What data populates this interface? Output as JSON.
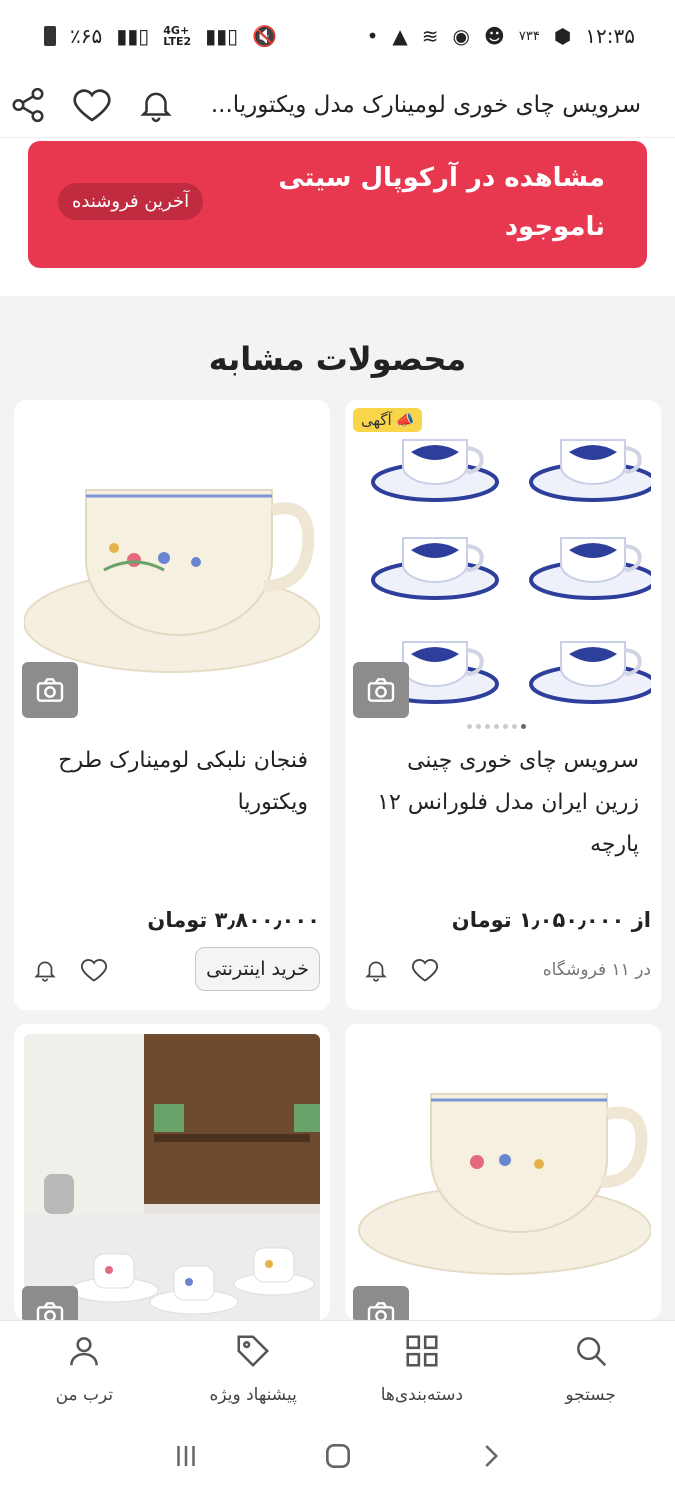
{
  "status_bar": {
    "time": "۱۲:۳۵",
    "battery": "٪۶۵",
    "network1": "4G+",
    "network2": "LTE2",
    "extra": "۷۳۴"
  },
  "header": {
    "title": "سرویس چای خوری لومینارک مدل ویکتوریا...",
    "icons": [
      "share-icon",
      "heart-icon",
      "bell-icon"
    ]
  },
  "banner": {
    "store_line": "مشاهده در آرکوپال سیتی",
    "availability": "ناموجود",
    "badge": "آخرین فروشنده",
    "color": "#e8384f"
  },
  "similar": {
    "title": "محصولات مشابه",
    "products": [
      {
        "name": "سرویس چای خوری چینی زرین ایران مدل فلورانس ۱۲ پارچه",
        "price": "از ۱٫۰۵۰٫۰۰۰ تومان",
        "stores": "در ۱۱ فروشگاه",
        "ad_label": "آگهی",
        "image": "blue-white-teacups"
      },
      {
        "name": "فنجان نلبکی لومینارک طرح ویکتوریا",
        "price": "۳٫۸۰۰٫۰۰۰ تومان",
        "buy_label": "خرید اینترنتی",
        "image": "floral-teacup"
      },
      {
        "image": "floral-teacup"
      },
      {
        "image": "tea-set-table"
      }
    ]
  },
  "bottom_nav": [
    {
      "label": "جستجو",
      "icon": "search-icon"
    },
    {
      "label": "دسته‌بندی‌ها",
      "icon": "grid-icon"
    },
    {
      "label": "پیشنهاد ویژه",
      "icon": "tag-icon"
    },
    {
      "label": "ترب من",
      "icon": "user-icon"
    }
  ]
}
